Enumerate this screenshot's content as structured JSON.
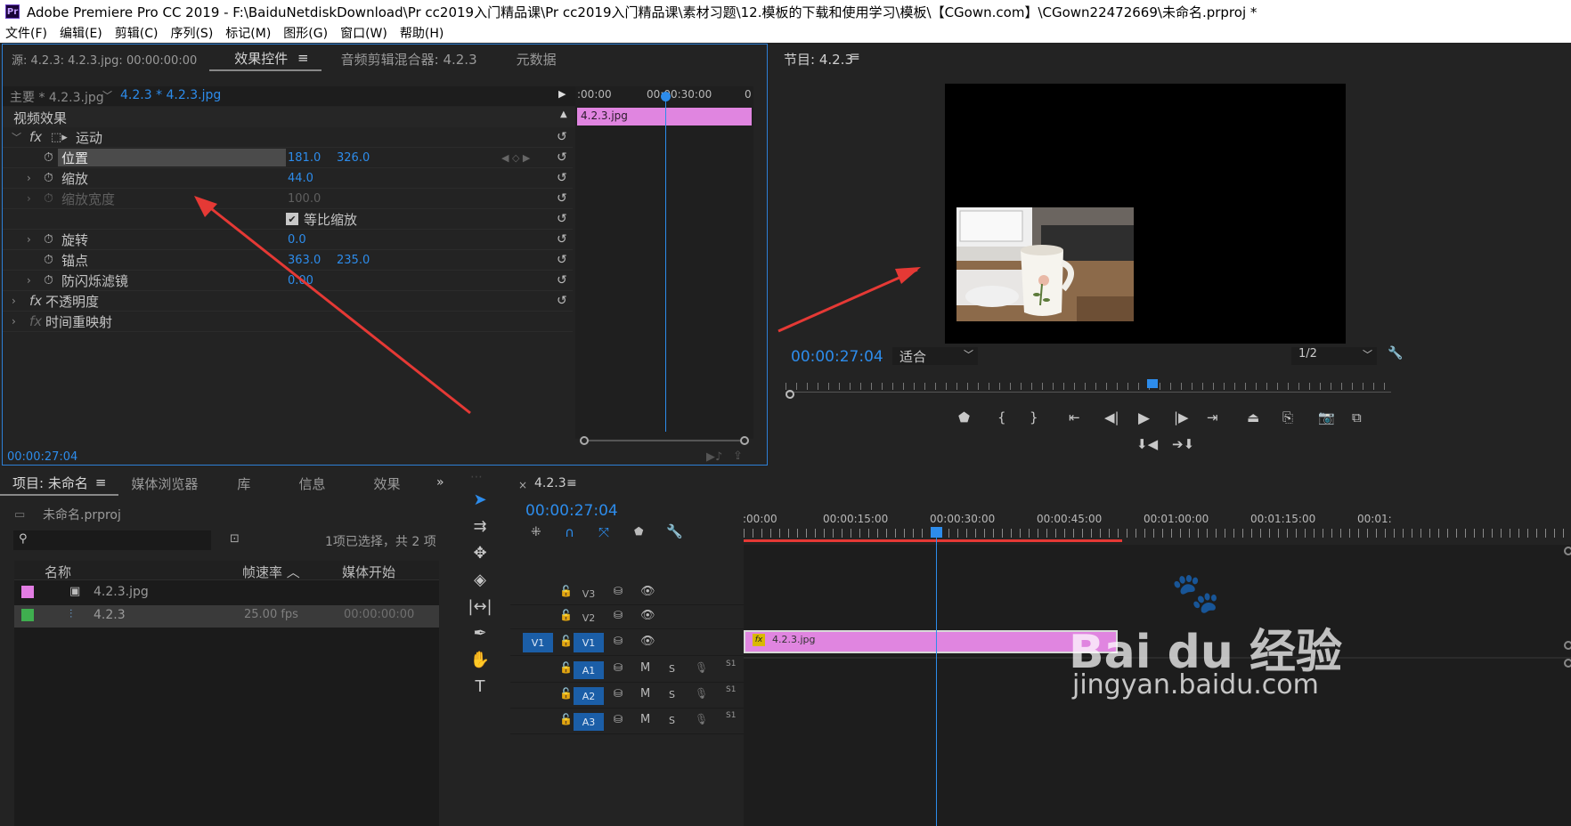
{
  "window": {
    "title": "Adobe Premiere Pro CC 2019 - F:\\BaiduNetdiskDownload\\Pr cc2019入门精品课\\Pr cc2019入门精品课\\素材习题\\12.模板的下载和使用学习\\模板\\【CGown.com】\\CGown22472669\\未命名.prproj *",
    "logo": "Pr"
  },
  "menu": [
    "文件(F)",
    "编辑(E)",
    "剪辑(C)",
    "序列(S)",
    "标记(M)",
    "图形(G)",
    "窗口(W)",
    "帮助(H)"
  ],
  "source_panel": {
    "tabs": [
      "源: 4.2.3: 4.2.3.jpg: 00:00:00:00",
      "效果控件",
      "音频剪辑混合器: 4.2.3",
      "元数据"
    ],
    "menu_icon": "≡",
    "master": "主要 * 4.2.3.jpg",
    "sequence": "4.2.3 * 4.2.3.jpg",
    "section": "视频效果",
    "rows": {
      "motion": "运动",
      "position": {
        "label": "位置",
        "v1": "181.0",
        "v2": "326.0"
      },
      "scale": {
        "label": "缩放",
        "v1": "44.0"
      },
      "scale_width": {
        "label": "缩放宽度",
        "v1": "100.0"
      },
      "uniform": "等比缩放",
      "rotation": {
        "label": "旋转",
        "v1": "0.0"
      },
      "anchor": {
        "label": "锚点",
        "v1": "363.0",
        "v2": "235.0"
      },
      "flicker": {
        "label": "防闪烁滤镜",
        "v1": "0.00"
      },
      "opacity": "不透明度",
      "remap": "时间重映射"
    },
    "fx": "fx",
    "mini_ruler": [
      ":00:00",
      "00:00:30:00",
      "0"
    ],
    "clip": "4.2.3.jpg",
    "timecode": "00:00:27:04"
  },
  "program": {
    "title": "节目: 4.2.3",
    "timecode": "00:00:27:04",
    "fit": "适合",
    "resolution": "1/2"
  },
  "project": {
    "tabs": [
      "项目: 未命名",
      "媒体浏览器",
      "库",
      "信息",
      "效果"
    ],
    "file": "未命名.prproj",
    "selection": "1项已选择，共 2 项",
    "columns": [
      "名称",
      "帧速率",
      "媒体开始"
    ],
    "items": [
      {
        "name": "4.2.3.jpg",
        "fps": "",
        "start": "",
        "color": "#e27de3"
      },
      {
        "name": "4.2.3",
        "fps": "25.00 fps",
        "start": "00:00:00:00",
        "color": "#3fae4f"
      }
    ]
  },
  "timeline": {
    "name": "4.2.3",
    "timecode": "00:00:27:04",
    "ruler": [
      ":00:00",
      "00:00:15:00",
      "00:00:30:00",
      "00:00:45:00",
      "00:01:00:00",
      "00:01:15:00",
      "00:01:"
    ],
    "clip": "4.2.3.jpg",
    "video_tracks": [
      "V3",
      "V2",
      "V1"
    ],
    "audio_tracks": [
      "A1",
      "A2",
      "A3"
    ],
    "source_patch": "V1",
    "mute": "M",
    "solo": "S",
    "level": "S1"
  },
  "watermark": {
    "brand": "Bai du 经验",
    "url": "jingyan.baidu.com"
  },
  "colors": {
    "accent": "#2d8ceb",
    "clip": "#e085e0",
    "arrow": "#e53935",
    "panel": "#232323"
  }
}
